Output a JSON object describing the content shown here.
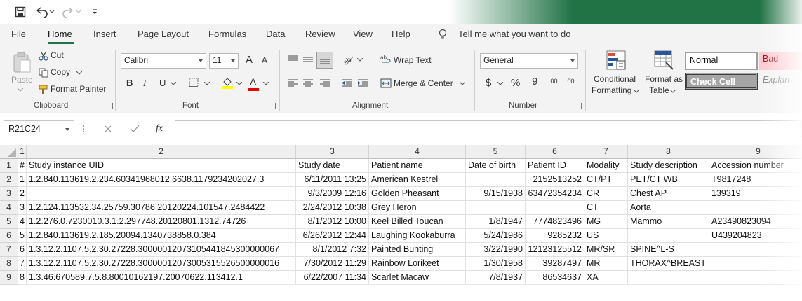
{
  "tabs": [
    "File",
    "Home",
    "Insert",
    "Page Layout",
    "Formulas",
    "Data",
    "Review",
    "View",
    "Help"
  ],
  "tell_me": "Tell me what you want to do",
  "clipboard": {
    "paste": "Paste",
    "cut": "Cut",
    "copy": "Copy",
    "format_painter": "Format Painter",
    "label": "Clipboard"
  },
  "font": {
    "name": "Calibri",
    "size": "11",
    "label": "Font",
    "bold": "B",
    "italic": "I",
    "underline": "U",
    "grow": "A",
    "shrink": "A",
    "font_color": "A"
  },
  "alignment": {
    "wrap_text": "Wrap Text",
    "merge_center": "Merge & Center",
    "label": "Alignment"
  },
  "number": {
    "format": "General",
    "label": "Number",
    "currency": "$",
    "percent": "%",
    "comma": "9",
    "increase_decimal": ".00",
    "decrease_decimal": ".00"
  },
  "styles": {
    "conditional_formatting": [
      "Conditional",
      "Formatting"
    ],
    "format_as_table": [
      "Format as",
      "Table"
    ],
    "normal": "Normal",
    "bad": "Bad",
    "check_cell": "Check Cell",
    "explanatory": "Explan"
  },
  "name_box": "R21C24",
  "fx": "fx",
  "grid": {
    "col_headers": [
      "1",
      "2",
      "3",
      "4",
      "5",
      "6",
      "7",
      "8",
      "9"
    ],
    "rows": [
      {
        "n": "1",
        "cells": [
          "#",
          "Study instance UID",
          "Study date",
          "Patient name",
          "Date of birth",
          "Patient ID",
          "Modality",
          "Study description",
          "Accession number"
        ]
      },
      {
        "n": "2",
        "cells": [
          "1",
          "1.2.840.113619.2.234.60341968012.6638.1179234202027.3",
          "6/11/2011 13:25",
          "American Kestrel",
          "",
          "2152513252",
          "CT/PT",
          "PET/CT WB",
          "T9817248"
        ]
      },
      {
        "n": "3",
        "cells": [
          "2",
          "",
          "9/3/2009 12:16",
          "Golden Pheasant",
          "9/15/1938",
          "63472354234",
          "CR",
          "Chest AP",
          "139319"
        ]
      },
      {
        "n": "4",
        "cells": [
          "3",
          "1.2.124.113532.34.25759.30786.20120224.101547.2484422",
          "2/24/2012 10:38",
          "Grey Heron",
          "",
          "",
          "CT",
          "Aorta",
          ""
        ]
      },
      {
        "n": "5",
        "cells": [
          "4",
          "1.2.276.0.7230010.3.1.2.297748.20120801.1312.74726",
          "8/1/2012 10:00",
          "Keel Billed Toucan",
          "1/8/1947",
          "7774823496",
          "MG",
          "Mammo",
          "A23490823094"
        ]
      },
      {
        "n": "6",
        "cells": [
          "5",
          "1.2.840.113619.2.185.20094.1340738858.0.384",
          "6/26/2012 12:44",
          "Laughing Kookaburra",
          "5/24/1986",
          "9285232",
          "US",
          "",
          "U439204823"
        ]
      },
      {
        "n": "7",
        "cells": [
          "6",
          "1.3.12.2.1107.5.2.30.27228.30000012073105441845300000067",
          "8/1/2012 7:32",
          "Painted Bunting",
          "3/22/1990",
          "12123125512",
          "MR/SR",
          "SPINE^L-S",
          ""
        ]
      },
      {
        "n": "8",
        "cells": [
          "7",
          "1.3.12.2.1107.5.2.30.27228.30000012073005315526500000016",
          "7/30/2012 11:29",
          "Rainbow Lorikeet",
          "1/30/1958",
          "39287497",
          "MR",
          "THORAX^BREAST",
          ""
        ]
      },
      {
        "n": "9",
        "cells": [
          "8",
          "1.3.46.670589.7.5.8.80010162197.20070622.113412.1",
          "6/22/2007 11:34",
          "Scarlet Macaw",
          "7/8/1937",
          "86534637",
          "XA",
          "",
          ""
        ]
      }
    ]
  },
  "colors": {
    "accent": "#217346",
    "ribbon_bg": "#f3f3f3",
    "bad_bg": "#ffc7ce",
    "bad_fg": "#9c0006",
    "check_bg": "#a5a5a5"
  }
}
